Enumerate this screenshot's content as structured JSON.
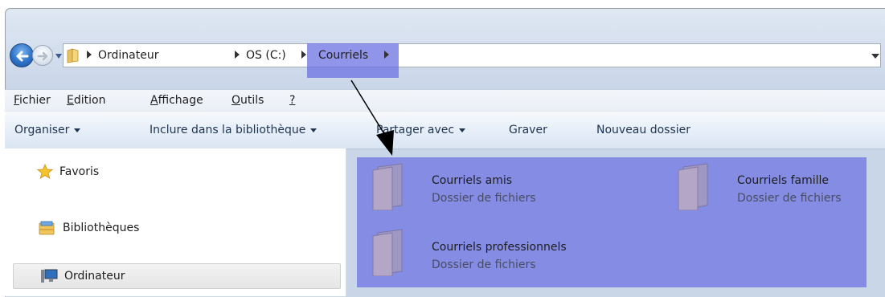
{
  "address": {
    "breadcrumbs": [
      "Ordinateur",
      "OS (C:)",
      "Courriels"
    ]
  },
  "menu": {
    "items": [
      {
        "underline": "F",
        "rest": "ichier"
      },
      {
        "underline": "E",
        "rest": "dition"
      },
      {
        "underline": "A",
        "rest": "ffichage"
      },
      {
        "underline": "O",
        "rest": "utils"
      },
      {
        "underline": "?",
        "rest": ""
      }
    ]
  },
  "toolbar": {
    "organiser": "Organiser",
    "include": "Inclure dans la bibliothèque",
    "share": "Partager avec",
    "burn": "Graver",
    "new_folder": "Nouveau dossier"
  },
  "navigation": {
    "favorites": "Favoris",
    "libraries": "Bibliothèques",
    "computer": "Ordinateur"
  },
  "content": {
    "items": [
      {
        "name": "Courriels amis",
        "type": "Dossier de fichiers"
      },
      {
        "name": "Courriels famille",
        "type": "Dossier de fichiers"
      },
      {
        "name": "Courriels professionnels",
        "type": "Dossier de fichiers"
      }
    ]
  },
  "icons": {
    "back": "back-arrow-icon",
    "forward": "forward-arrow-icon",
    "recent": "chevron-down-icon",
    "address_folder": "folder-icon",
    "favorites": "star-icon",
    "libraries": "library-icon",
    "computer": "computer-icon",
    "folder": "folder-icon"
  },
  "colors": {
    "highlight": "#666ce2",
    "window_chrome": "#d2dded",
    "back_button": "#2e73c9"
  }
}
